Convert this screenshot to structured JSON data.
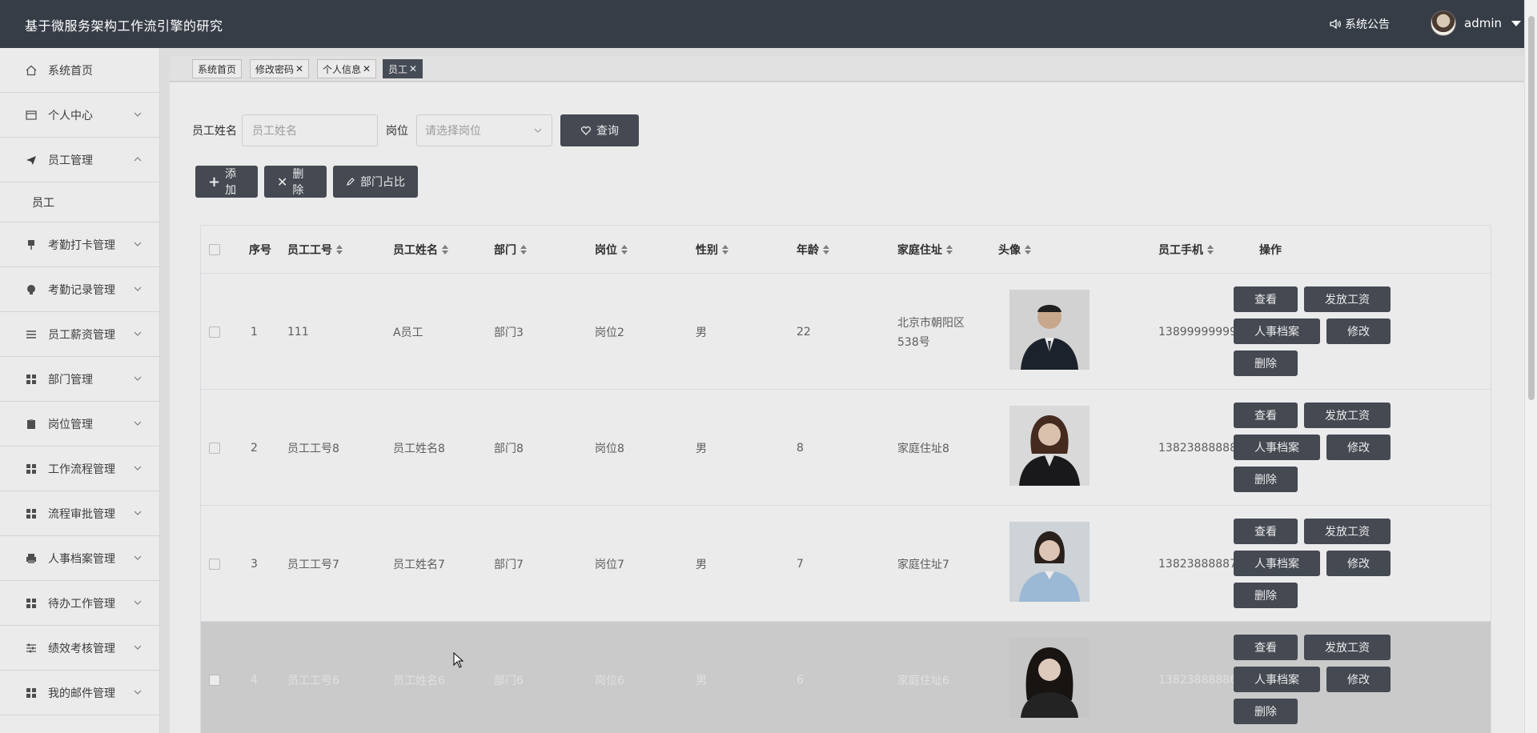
{
  "header": {
    "site_title": "基于微服务架构工作流引擎的研究",
    "notice": "系统公告",
    "username": "admin"
  },
  "sidebar": {
    "items": [
      {
        "label": "系统首页",
        "icon": "home-icon",
        "expandable": false
      },
      {
        "label": "个人中心",
        "icon": "id-card-icon",
        "expandable": true
      },
      {
        "label": "员工管理",
        "icon": "paper-plane-icon",
        "expandable": true,
        "expanded": true
      },
      {
        "label": "考勤打卡管理",
        "icon": "pin-icon",
        "expandable": true
      },
      {
        "label": "考勤记录管理",
        "icon": "bulb-icon",
        "expandable": true
      },
      {
        "label": "员工薪资管理",
        "icon": "list-icon",
        "expandable": true
      },
      {
        "label": "部门管理",
        "icon": "grid-icon",
        "expandable": true
      },
      {
        "label": "岗位管理",
        "icon": "clipboard-icon",
        "expandable": true
      },
      {
        "label": "工作流程管理",
        "icon": "grid-icon",
        "expandable": true
      },
      {
        "label": "流程审批管理",
        "icon": "grid-icon",
        "expandable": true
      },
      {
        "label": "人事档案管理",
        "icon": "printer-icon",
        "expandable": true
      },
      {
        "label": "待办工作管理",
        "icon": "grid-icon",
        "expandable": true
      },
      {
        "label": "绩效考核管理",
        "icon": "sliders-icon",
        "expandable": true
      },
      {
        "label": "我的邮件管理",
        "icon": "grid-icon",
        "expandable": true
      }
    ],
    "submenu": {
      "label": "员工"
    }
  },
  "tabs": [
    {
      "label": "系统首页",
      "closable": false
    },
    {
      "label": "修改密码",
      "closable": true
    },
    {
      "label": "个人信息",
      "closable": true
    },
    {
      "label": "员工",
      "closable": true,
      "active": true
    }
  ],
  "search": {
    "name_label": "员工姓名",
    "name_placeholder": "员工姓名",
    "post_label": "岗位",
    "post_placeholder": "请选择岗位",
    "query_button": "查询"
  },
  "actions": {
    "add": "添加",
    "delete": "删除",
    "dept_ratio": "部门占比"
  },
  "table": {
    "headers": [
      "序号",
      "员工工号",
      "员工姓名",
      "部门",
      "岗位",
      "性别",
      "年龄",
      "家庭住址",
      "头像",
      "员工手机",
      "操作"
    ],
    "op_labels": {
      "view": "查看",
      "salary": "发放工资",
      "archive": "人事档案",
      "edit": "修改",
      "delete": "删除"
    },
    "rows": [
      {
        "idx": "1",
        "emp_no": "111",
        "name": "A员工",
        "dept": "部门3",
        "post": "岗位2",
        "gender": "男",
        "age": "22",
        "address": "北京市朝阳区538号",
        "phone": "13899999999",
        "photo": "man-in-suit"
      },
      {
        "idx": "2",
        "emp_no": "员工工号8",
        "name": "员工姓名8",
        "dept": "部门8",
        "post": "岗位8",
        "gender": "男",
        "age": "8",
        "address": "家庭住址8",
        "phone": "13823888888",
        "photo": "woman-black-suit"
      },
      {
        "idx": "3",
        "emp_no": "员工工号7",
        "name": "员工姓名7",
        "dept": "部门7",
        "post": "岗位7",
        "gender": "男",
        "age": "7",
        "address": "家庭住址7",
        "phone": "13823888887",
        "photo": "woman-blue-shirt"
      },
      {
        "idx": "4",
        "emp_no": "员工工号6",
        "name": "员工姓名6",
        "dept": "部门6",
        "post": "岗位6",
        "gender": "男",
        "age": "6",
        "address": "家庭住址6",
        "phone": "13823888886",
        "photo": "woman-short-hair"
      }
    ]
  }
}
